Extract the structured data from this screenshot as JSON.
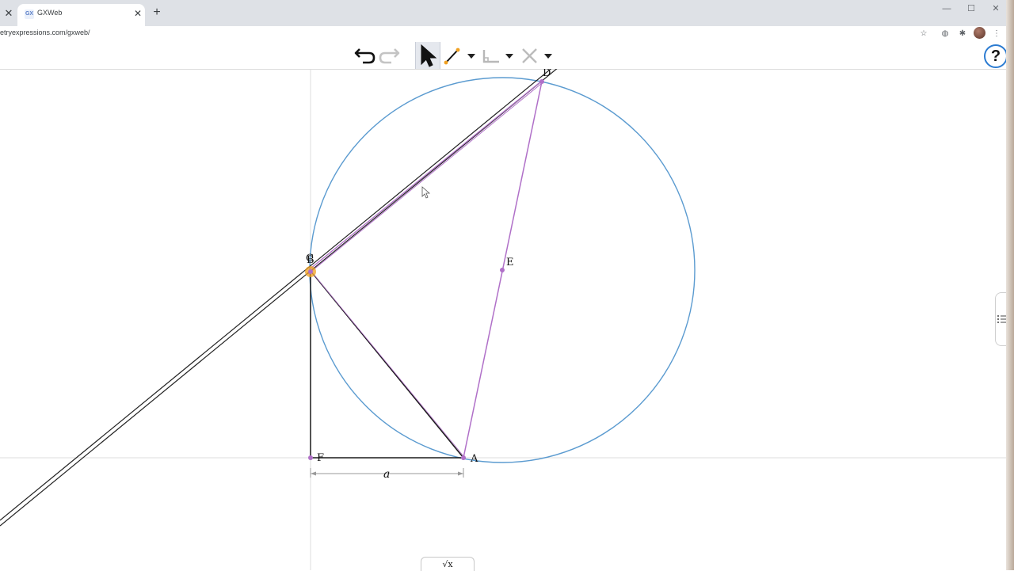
{
  "browser": {
    "tab_title": "GXWeb",
    "favicon_text": "GX",
    "url": "etryexpressions.com/gxweb/",
    "icons": {
      "prev_tab_close": "close-icon",
      "tab_close": "close-icon",
      "new_tab": "plus-icon",
      "minimize": "minimize-icon",
      "maximize": "maximize-icon",
      "close_window": "close-icon",
      "bookmark": "star-icon",
      "extension_1": "circle-icon",
      "extensions": "puzzle-icon",
      "menu": "kebab-icon"
    }
  },
  "toolbar": {
    "tools": [
      "undo-icon",
      "redo-icon",
      "select-arrow-icon",
      "segment-tool-icon",
      "measure-tool-icon",
      "delete-tool-icon"
    ],
    "help_label": "?"
  },
  "canvas": {
    "points": {
      "A": "A",
      "B": "B",
      "C": "C",
      "D": "D",
      "E": "E",
      "F": "F"
    },
    "measure_label": "a",
    "colors": {
      "circle": "#5b9bd0",
      "purple_lines": "#b070c8",
      "black_lines": "#1a1a1a",
      "highlight_point": "#f0a020",
      "axis": "#d0d0d0"
    }
  },
  "formula_tab_label": "√x"
}
